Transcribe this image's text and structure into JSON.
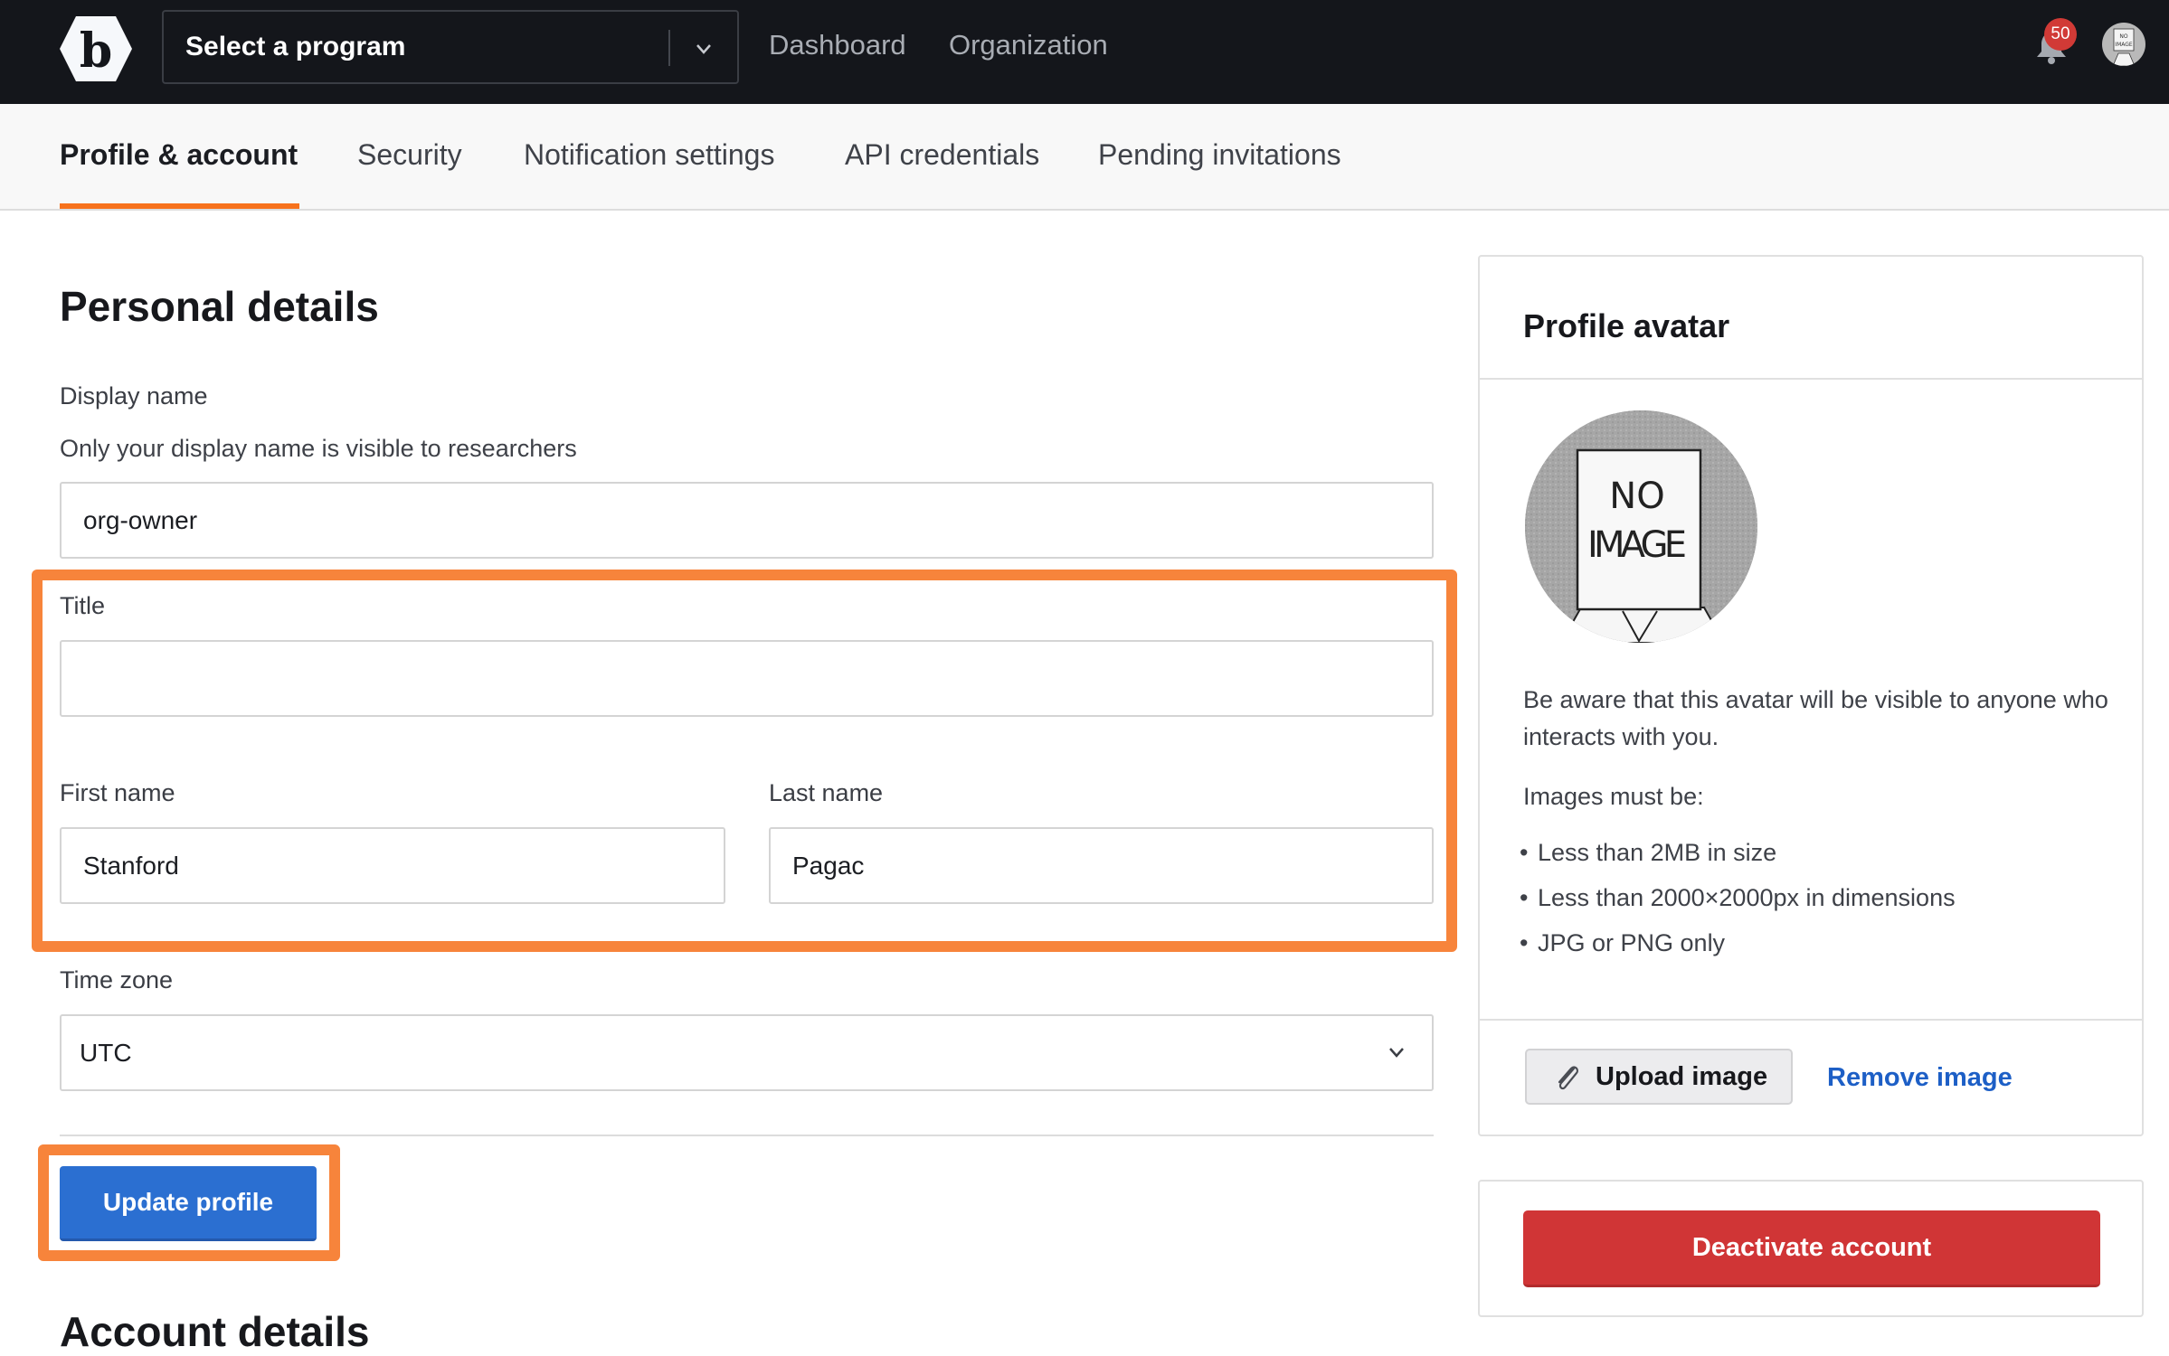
{
  "topbar": {
    "logo_letter": "b",
    "program_select": {
      "value": "Select a program"
    },
    "nav": [
      {
        "label": "Dashboard"
      },
      {
        "label": "Organization"
      }
    ],
    "notifications": {
      "count": "50"
    },
    "avatar_text": "NO IMAGE"
  },
  "tabs": [
    {
      "label": "Profile & account",
      "active": true
    },
    {
      "label": "Security",
      "active": false
    },
    {
      "label": "Notification settings",
      "active": false
    },
    {
      "label": "API credentials",
      "active": false
    },
    {
      "label": "Pending invitations",
      "active": false
    }
  ],
  "personal": {
    "heading": "Personal details",
    "display_name": {
      "label": "Display name",
      "help": "Only your display name is visible to researchers",
      "value": "org-owner"
    },
    "title": {
      "label": "Title",
      "value": ""
    },
    "first_name": {
      "label": "First name",
      "value": "Stanford"
    },
    "last_name": {
      "label": "Last name",
      "value": "Pagac"
    },
    "time_zone": {
      "label": "Time zone",
      "value": "UTC"
    },
    "submit_label": "Update profile",
    "next_heading": "Account details"
  },
  "avatar_card": {
    "title": "Profile avatar",
    "image_text": [
      "NO",
      "IMAGE"
    ],
    "notice": "Be aware that this avatar will be visible to anyone who interacts with you.",
    "requirements_intro": "Images must be:",
    "requirements": [
      "Less than 2MB in size",
      "Less than 2000×2000px in dimensions",
      "JPG or PNG only"
    ],
    "upload_label": "Upload image",
    "remove_label": "Remove image"
  },
  "danger": {
    "deactivate_label": "Deactivate account"
  },
  "colors": {
    "topbar_bg": "#14161b",
    "accent_tab": "#f7721c",
    "highlight": "#f7843b",
    "primary": "#2b6fd1",
    "link": "#1d5fc6",
    "danger": "#d03536",
    "badge": "#d13a36"
  }
}
